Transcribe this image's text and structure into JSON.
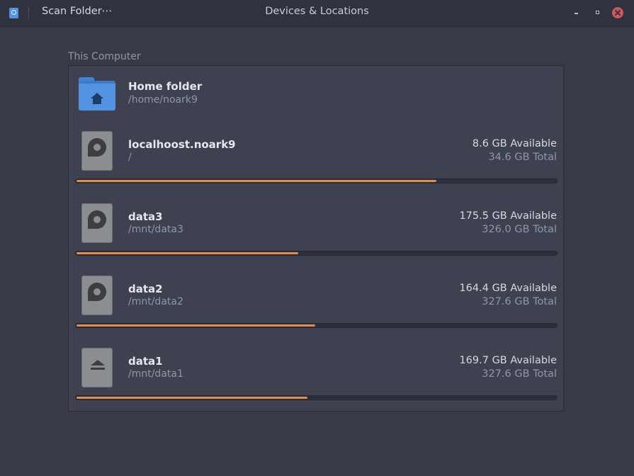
{
  "titlebar": {
    "scan_button_label": "Scan Folder⋯",
    "title": "Devices & Locations"
  },
  "section": {
    "label": "This Computer"
  },
  "home": {
    "name": "Home folder",
    "path": "/home/noark9"
  },
  "devices": [
    {
      "name": "localhoost.noark9",
      "path": "/",
      "available": "8.6 GB Available",
      "total": "34.6 GB Total",
      "used_fraction": 0.751,
      "icon": "harddisk-icon"
    },
    {
      "name": "data3",
      "path": "/mnt/data3",
      "available": "175.5 GB Available",
      "total": "326.0 GB Total",
      "used_fraction": 0.462,
      "icon": "harddisk-icon"
    },
    {
      "name": "data2",
      "path": "/mnt/data2",
      "available": "164.4 GB Available",
      "total": "327.6 GB Total",
      "used_fraction": 0.498,
      "icon": "harddisk-icon"
    },
    {
      "name": "data1",
      "path": "/mnt/data1",
      "available": "169.7 GB Available",
      "total": "327.6 GB Total",
      "used_fraction": 0.482,
      "icon": "eject-drive-icon"
    }
  ],
  "colors": {
    "accent": "#e38c4c",
    "folder": "#5294e2",
    "background": "#373b48"
  }
}
